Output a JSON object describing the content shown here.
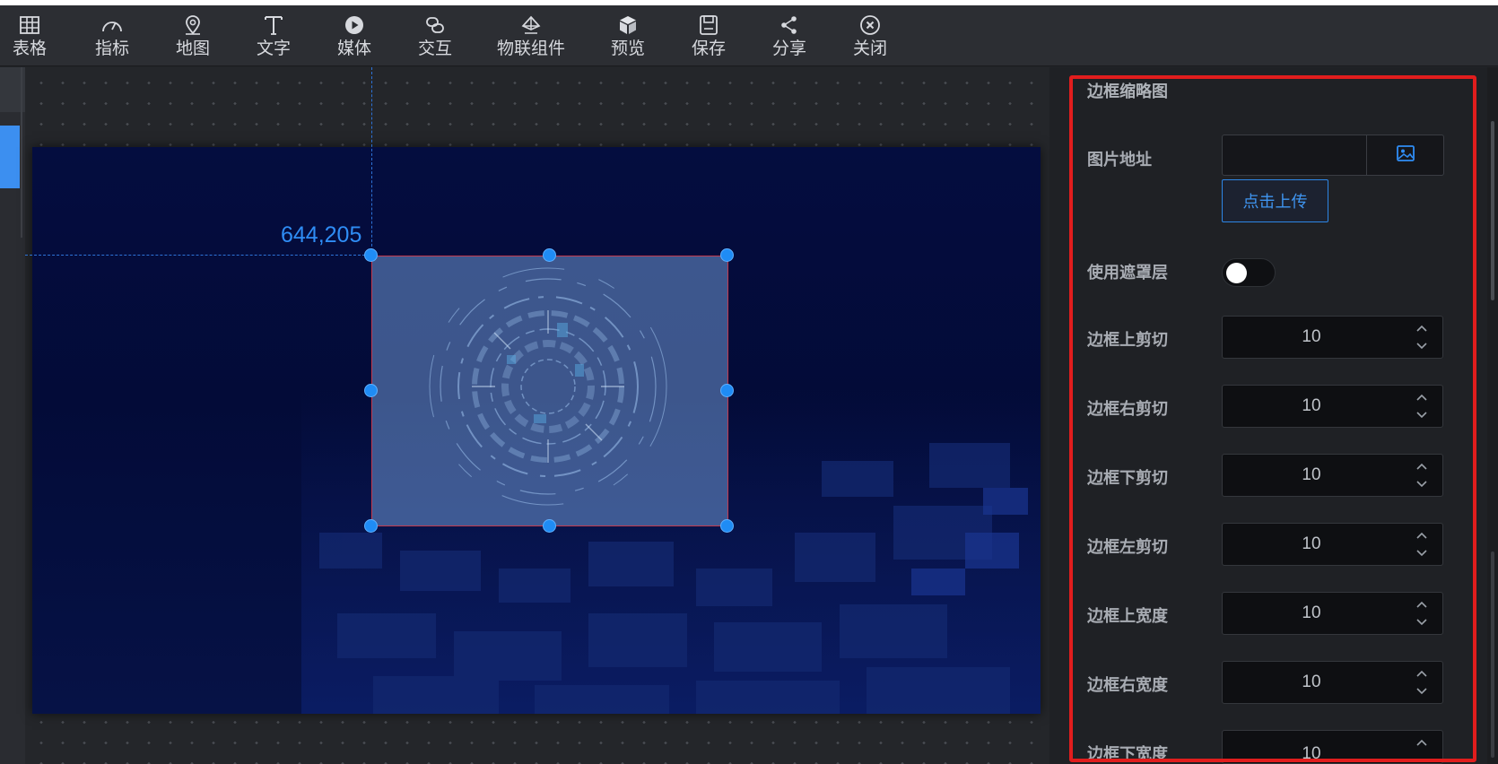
{
  "toolbar": {
    "items": [
      {
        "label": "表格",
        "icon": "table-icon"
      },
      {
        "label": "指标",
        "icon": "gauge-icon"
      },
      {
        "label": "地图",
        "icon": "map-pin-icon"
      },
      {
        "label": "文字",
        "icon": "text-icon"
      },
      {
        "label": "媒体",
        "icon": "play-icon"
      },
      {
        "label": "交互",
        "icon": "link-icon"
      },
      {
        "label": "物联组件",
        "icon": "iot-icon"
      },
      {
        "label": "预览",
        "icon": "cube-icon"
      },
      {
        "label": "保存",
        "icon": "save-icon"
      },
      {
        "label": "分享",
        "icon": "share-icon"
      },
      {
        "label": "关闭",
        "icon": "close-circle-icon"
      }
    ]
  },
  "canvas": {
    "coordinate_readout": "644,205"
  },
  "panel": {
    "section_title": "边框缩略图",
    "image_url_label": "图片地址",
    "image_url_value": "",
    "upload_label": "点击上传",
    "mask_label": "使用遮罩层",
    "mask_enabled": false,
    "fields": [
      {
        "label": "边框上剪切",
        "value": "10"
      },
      {
        "label": "边框右剪切",
        "value": "10"
      },
      {
        "label": "边框下剪切",
        "value": "10"
      },
      {
        "label": "边框左剪切",
        "value": "10"
      },
      {
        "label": "边框上宽度",
        "value": "10"
      },
      {
        "label": "边框右宽度",
        "value": "10"
      },
      {
        "label": "边框下宽度",
        "value": "10"
      }
    ]
  },
  "colors": {
    "accent": "#1f8cf5",
    "highlight_frame": "#e11d1d",
    "stage_background": "#040d3f"
  }
}
